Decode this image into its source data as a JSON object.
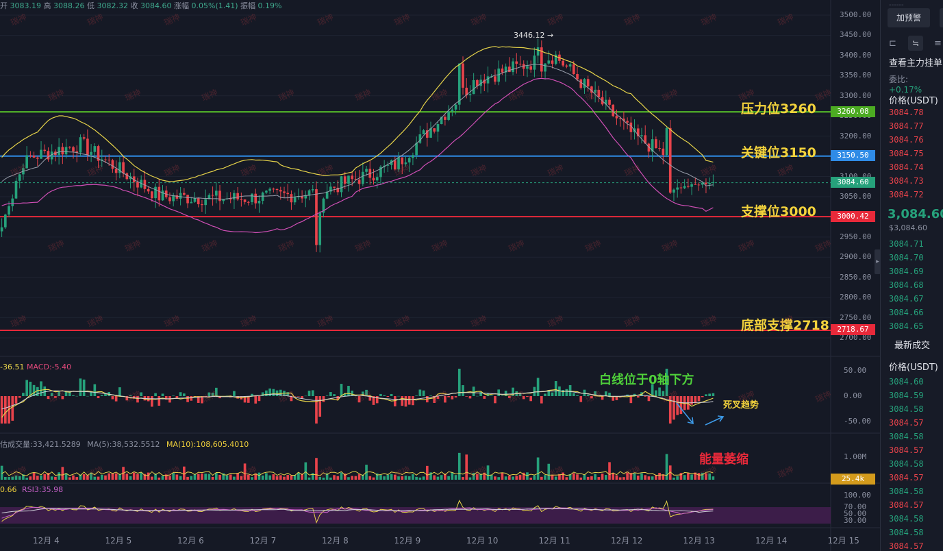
{
  "ohlc": {
    "open_label": "开",
    "open": "3083.19",
    "high_label": "高",
    "high": "3088.26",
    "low_label": "低",
    "low": "3082.32",
    "close_label": "收",
    "close": "3084.60",
    "chg_label": "涨幅",
    "chg": "0.05%(1.41)",
    "amp_label": "振幅",
    "amp": "0.19%"
  },
  "price_axis": [
    "3500.00",
    "3450.00",
    "3400.00",
    "3350.00",
    "3300.00",
    "3250.00",
    "3200.00",
    "3150.00",
    "3100.00",
    "3050.00",
    "3000.00",
    "2950.00",
    "2900.00",
    "2850.00",
    "2800.00",
    "2750.00",
    "2700.00"
  ],
  "macd_axis": [
    "50.00",
    "0.00",
    "-50.00"
  ],
  "vol_axis": [
    "1.00M"
  ],
  "rsi_axis": [
    "100.00",
    "70.00",
    "50.00",
    "30.00"
  ],
  "x_ticks": [
    "12月 4",
    "12月 5",
    "12月 6",
    "12月 7",
    "12月 8",
    "12月 9",
    "12月 10",
    "12月 11",
    "12月 12",
    "12月 13",
    "12月 14",
    "12月 15"
  ],
  "levels": {
    "resistance": {
      "label": "压力位3260",
      "tag": "3260.08",
      "color": "#59c72a"
    },
    "key": {
      "label": "关键位3150",
      "tag": "3150.50",
      "color": "#2f8be6"
    },
    "current": {
      "tag": "3084.60",
      "color": "#26a17b"
    },
    "support": {
      "label": "支撑位3000",
      "tag": "3000.42",
      "color": "#e8293a"
    },
    "bottom": {
      "label": "底部支撑2718",
      "tag": "2718.67",
      "color": "#e8293a"
    }
  },
  "peak_label": "3446.12 →",
  "macd_legend": {
    "dif": "-36.51",
    "macd_label": "MACD:",
    "macd": "-5.40"
  },
  "vol_legend": {
    "vol": "估成交量:33,421.5289",
    "ma5": "MA(5):38,532.5512",
    "ma10": "MA(10):108,605.4010"
  },
  "vol_tag": "25.4k",
  "rsi_legend": {
    "rsi1": "0.66",
    "rsi3": "RSI3:35.98"
  },
  "annotations": {
    "white_line": "白线位于0轴下方",
    "death_cross": "死叉趋势",
    "volume": "能量萎缩"
  },
  "watermark": "瑞神",
  "side": {
    "alert_btn": "加预警",
    "title": "查看主力挂单",
    "ratio_label": "委比:",
    "ratio": "+0.17%",
    "price_head": "价格(USDT)",
    "asks": [
      "3084.78",
      "3084.77",
      "3084.76",
      "3084.75",
      "3084.74",
      "3084.73",
      "3084.72"
    ],
    "last": "3,084.60",
    "last_sub": "$3,084.60",
    "bids": [
      "3084.71",
      "3084.70",
      "3084.69",
      "3084.68",
      "3084.67",
      "3084.66",
      "3084.65"
    ],
    "trades_head": "最新成交",
    "price_head2": "价格(USDT)",
    "trades": [
      {
        "p": "3084.60",
        "c": "up"
      },
      {
        "p": "3084.59",
        "c": "up"
      },
      {
        "p": "3084.58",
        "c": "up"
      },
      {
        "p": "3084.57",
        "c": "down"
      },
      {
        "p": "3084.58",
        "c": "up"
      },
      {
        "p": "3084.57",
        "c": "down"
      },
      {
        "p": "3084.58",
        "c": "up"
      },
      {
        "p": "3084.57",
        "c": "down"
      },
      {
        "p": "3084.58",
        "c": "up"
      },
      {
        "p": "3084.57",
        "c": "down"
      },
      {
        "p": "3084.58",
        "c": "up"
      },
      {
        "p": "3084.58",
        "c": "up"
      },
      {
        "p": "3084.57",
        "c": "down"
      }
    ]
  },
  "colors": {
    "up": "#26a17b",
    "down": "#e8434b",
    "bg": "#151925",
    "grid": "#222736"
  },
  "chart_data": {
    "type": "line",
    "title": "",
    "xlabel": "",
    "ylabel": "",
    "ylim": [
      2700,
      3500
    ],
    "series": [
      {
        "x": [
          "12月 4",
          "12月 5",
          "12月 6",
          "12月 7",
          "12月 8",
          "12月 9",
          "12月 10",
          "12月 11",
          "12月 12",
          "12月 13"
        ],
        "values": [
          3130,
          3180,
          3050,
          3045,
          3060,
          3130,
          3340,
          3400,
          3200,
          3085
        ]
      }
    ],
    "horizontal_levels": [
      3260.08,
      3150.5,
      3084.6,
      3000.42,
      2718.67
    ],
    "peak": 3446.12
  }
}
